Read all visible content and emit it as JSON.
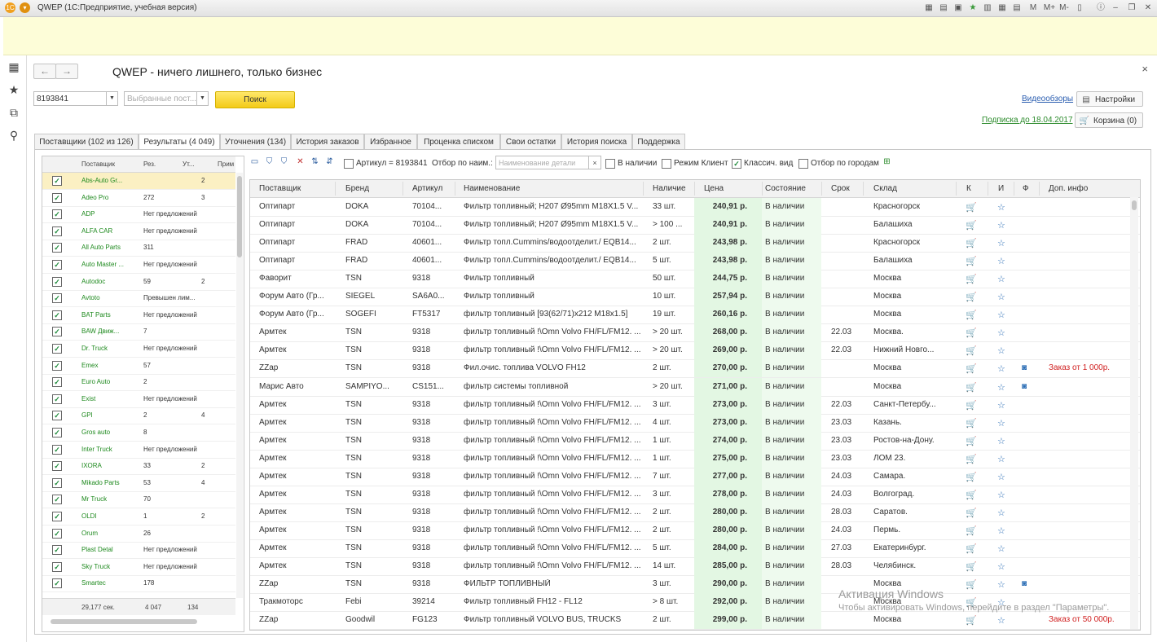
{
  "titlebar": {
    "title": "QWEP  (1С:Предприятие, учебная версия)",
    "icons": [
      "M",
      "M+",
      "M-"
    ]
  },
  "header": {
    "app_title": "QWEP - ничего лишнего, только бизнес"
  },
  "search": {
    "article_value": "8193841",
    "suppliers_placeholder": "Выбранные пост...",
    "search_label": "Поиск"
  },
  "right_links": {
    "video_label": "Видеообзоры",
    "settings_label": "Настройки",
    "subscription_label": "Подписка до 18.04.2017",
    "cart_label": "Корзина (0)"
  },
  "tabs": [
    {
      "label": "Поставщики (102 из 126)",
      "active": false
    },
    {
      "label": "Результаты (4 049)",
      "active": true
    },
    {
      "label": "Уточнения (134)",
      "active": false
    },
    {
      "label": "История заказов",
      "active": false
    },
    {
      "label": "Избранное",
      "active": false
    },
    {
      "label": "Проценка  списком",
      "active": false
    },
    {
      "label": "Свои остатки",
      "active": false
    },
    {
      "label": "История поиска",
      "active": false
    },
    {
      "label": "Поддержка",
      "active": false
    }
  ],
  "left_list": {
    "columns": [
      "Поставщик",
      "Рез.",
      "Ут...",
      "Прим"
    ],
    "rows": [
      {
        "name": "Abs-Auto Gr...",
        "res": "",
        "ut": "2",
        "selected": true
      },
      {
        "name": "Adeo Pro",
        "res": "272",
        "ut": "3"
      },
      {
        "name": "ADP",
        "res": "Нет предложений",
        "ut": ""
      },
      {
        "name": "ALFA CAR",
        "res": "Нет предложений",
        "ut": ""
      },
      {
        "name": "All Auto Parts",
        "res": "311",
        "ut": ""
      },
      {
        "name": "Auto Master ...",
        "res": "Нет предложений",
        "ut": ""
      },
      {
        "name": "Autodoc",
        "res": "59",
        "ut": "2"
      },
      {
        "name": "Avtoto",
        "res": "Превышен лим...",
        "ut": ""
      },
      {
        "name": "BAT Parts",
        "res": "Нет предложений",
        "ut": ""
      },
      {
        "name": "BAW Движ...",
        "res": "7",
        "ut": ""
      },
      {
        "name": "Dr. Truck",
        "res": "Нет предложений",
        "ut": ""
      },
      {
        "name": "Emex",
        "res": "57",
        "ut": ""
      },
      {
        "name": "Euro Auto",
        "res": "2",
        "ut": ""
      },
      {
        "name": "Exist",
        "res": "Нет предложений",
        "ut": ""
      },
      {
        "name": "GPI",
        "res": "2",
        "ut": "4"
      },
      {
        "name": "Gros auto",
        "res": "8",
        "ut": ""
      },
      {
        "name": "Inter Truck",
        "res": "Нет предложений",
        "ut": ""
      },
      {
        "name": "IXORA",
        "res": "33",
        "ut": "2"
      },
      {
        "name": "Mikado Parts",
        "res": "53",
        "ut": "4"
      },
      {
        "name": "Mr Truck",
        "res": "70",
        "ut": ""
      },
      {
        "name": "OLDI",
        "res": "1",
        "ut": "2"
      },
      {
        "name": "Orum",
        "res": "26",
        "ut": ""
      },
      {
        "name": "Plast Detal",
        "res": "Нет предложений",
        "ut": ""
      },
      {
        "name": "Sky Truck",
        "res": "Нет предложений",
        "ut": ""
      },
      {
        "name": "Smartec",
        "res": "178",
        "ut": ""
      }
    ],
    "footer": {
      "time": "29,177 сек.",
      "res": "4 047",
      "ut": "134"
    }
  },
  "toolbar": {
    "article_filter": "Артикул = 8193841",
    "name_filter_label": "Отбор по наим.:",
    "name_filter_placeholder": "Наименование детали",
    "in_stock": "В наличии",
    "client_mode": "Режим Клиент",
    "classic_view": "Классич. вид",
    "city_filter": "Отбор по городам"
  },
  "grid": {
    "columns": [
      "Поставщик",
      "Бренд",
      "Артикул",
      "Наименование",
      "Наличие",
      "Цена",
      "Состояние",
      "Срок",
      "Склад",
      "К",
      "И",
      "Ф",
      "Доп. инфо"
    ],
    "rows": [
      {
        "supplier": "Оптипарт",
        "brand": "DOKA",
        "article": "70104...",
        "name": "Фильтр топливный; H207 Ø95mm M18X1.5 V...",
        "stock": "33 шт.",
        "price": "240,91 р.",
        "state": "В наличии",
        "term": "",
        "warehouse": "Красногорск",
        "cam": false,
        "info": ""
      },
      {
        "supplier": "Оптипарт",
        "brand": "DOKA",
        "article": "70104...",
        "name": "Фильтр топливный; H207 Ø95mm M18X1.5 V...",
        "stock": "> 100 ...",
        "price": "240,91 р.",
        "state": "В наличии",
        "term": "",
        "warehouse": "Балашиха",
        "cam": false,
        "info": ""
      },
      {
        "supplier": "Оптипарт",
        "brand": "FRAD",
        "article": "40601...",
        "name": "Фильтр топл.Cummins/водоотделит./ EQB14...",
        "stock": "2 шт.",
        "price": "243,98 р.",
        "state": "В наличии",
        "term": "",
        "warehouse": "Красногорск",
        "cam": false,
        "info": ""
      },
      {
        "supplier": "Оптипарт",
        "brand": "FRAD",
        "article": "40601...",
        "name": "Фильтр топл.Cummins/водоотделит./ EQB14...",
        "stock": "5 шт.",
        "price": "243,98 р.",
        "state": "В наличии",
        "term": "",
        "warehouse": "Балашиха",
        "cam": false,
        "info": ""
      },
      {
        "supplier": "Фаворит",
        "brand": "TSN",
        "article": "9318",
        "name": "Фильтр топливный",
        "stock": "50 шт.",
        "price": "244,75 р.",
        "state": "В наличии",
        "term": "",
        "warehouse": "Москва",
        "cam": false,
        "info": ""
      },
      {
        "supplier": "Форум Авто (Гр...",
        "brand": "SIEGEL",
        "article": "SA6A0...",
        "name": "Фильтр топливный",
        "stock": "10 шт.",
        "price": "257,94 р.",
        "state": "В наличии",
        "term": "",
        "warehouse": "Москва",
        "cam": false,
        "info": ""
      },
      {
        "supplier": "Форум Авто (Гр...",
        "brand": "SOGEFI",
        "article": "FT5317",
        "name": "фильтр топливный [93(62/71)x212 M18x1.5]",
        "stock": "19 шт.",
        "price": "260,16 р.",
        "state": "В наличии",
        "term": "",
        "warehouse": "Москва",
        "cam": false,
        "info": ""
      },
      {
        "supplier": "Армтек",
        "brand": "TSN",
        "article": "9318",
        "name": "фильтр топливный !\\Omn Volvo FH/FL/FM12. ...",
        "stock": "> 20 шт.",
        "price": "268,00 р.",
        "state": "В наличии",
        "term": "22.03",
        "warehouse": "Москва.",
        "cam": false,
        "info": ""
      },
      {
        "supplier": "Армтек",
        "brand": "TSN",
        "article": "9318",
        "name": "фильтр топливный !\\Omn Volvo FH/FL/FM12. ...",
        "stock": "> 20 шт.",
        "price": "269,00 р.",
        "state": "В наличии",
        "term": "22.03",
        "warehouse": "Нижний Новго...",
        "cam": false,
        "info": ""
      },
      {
        "supplier": "ZZap",
        "brand": "TSN",
        "article": "9318",
        "name": "Фил.очис. топлива VOLVO FH12",
        "stock": "2 шт.",
        "price": "270,00 р.",
        "state": "В наличии",
        "term": "",
        "warehouse": "Москва",
        "cam": true,
        "info": "Заказ от 1 000р."
      },
      {
        "supplier": "Марис Авто",
        "brand": "SAMPIYO...",
        "article": "CS151...",
        "name": "фильтр системы топливной",
        "stock": "> 20 шт.",
        "price": "271,00 р.",
        "state": "В наличии",
        "term": "",
        "warehouse": "Москва",
        "cam": true,
        "info": ""
      },
      {
        "supplier": "Армтек",
        "brand": "TSN",
        "article": "9318",
        "name": "фильтр топливный !\\Omn Volvo FH/FL/FM12. ...",
        "stock": "3 шт.",
        "price": "273,00 р.",
        "state": "В наличии",
        "term": "22.03",
        "warehouse": "Санкт-Петербу...",
        "cam": false,
        "info": ""
      },
      {
        "supplier": "Армтек",
        "brand": "TSN",
        "article": "9318",
        "name": "фильтр топливный !\\Omn Volvo FH/FL/FM12. ...",
        "stock": "4 шт.",
        "price": "273,00 р.",
        "state": "В наличии",
        "term": "23.03",
        "warehouse": "Казань.",
        "cam": false,
        "info": ""
      },
      {
        "supplier": "Армтек",
        "brand": "TSN",
        "article": "9318",
        "name": "фильтр топливный !\\Omn Volvo FH/FL/FM12. ...",
        "stock": "1 шт.",
        "price": "274,00 р.",
        "state": "В наличии",
        "term": "23.03",
        "warehouse": "Ростов-на-Дону.",
        "cam": false,
        "info": ""
      },
      {
        "supplier": "Армтек",
        "brand": "TSN",
        "article": "9318",
        "name": "фильтр топливный !\\Omn Volvo FH/FL/FM12. ...",
        "stock": "1 шт.",
        "price": "275,00 р.",
        "state": "В наличии",
        "term": "23.03",
        "warehouse": "ЛОМ 23.",
        "cam": false,
        "info": ""
      },
      {
        "supplier": "Армтек",
        "brand": "TSN",
        "article": "9318",
        "name": "фильтр топливный !\\Omn Volvo FH/FL/FM12. ...",
        "stock": "7 шт.",
        "price": "277,00 р.",
        "state": "В наличии",
        "term": "24.03",
        "warehouse": "Самара.",
        "cam": false,
        "info": ""
      },
      {
        "supplier": "Армтек",
        "brand": "TSN",
        "article": "9318",
        "name": "фильтр топливный !\\Omn Volvo FH/FL/FM12. ...",
        "stock": "3 шт.",
        "price": "278,00 р.",
        "state": "В наличии",
        "term": "24.03",
        "warehouse": "Волгоград.",
        "cam": false,
        "info": ""
      },
      {
        "supplier": "Армтек",
        "brand": "TSN",
        "article": "9318",
        "name": "фильтр топливный !\\Omn Volvo FH/FL/FM12. ...",
        "stock": "2 шт.",
        "price": "280,00 р.",
        "state": "В наличии",
        "term": "28.03",
        "warehouse": "Саратов.",
        "cam": false,
        "info": ""
      },
      {
        "supplier": "Армтек",
        "brand": "TSN",
        "article": "9318",
        "name": "фильтр топливный !\\Omn Volvo FH/FL/FM12. ...",
        "stock": "2 шт.",
        "price": "280,00 р.",
        "state": "В наличии",
        "term": "24.03",
        "warehouse": "Пермь.",
        "cam": false,
        "info": ""
      },
      {
        "supplier": "Армтек",
        "brand": "TSN",
        "article": "9318",
        "name": "фильтр топливный !\\Omn Volvo FH/FL/FM12. ...",
        "stock": "5 шт.",
        "price": "284,00 р.",
        "state": "В наличии",
        "term": "27.03",
        "warehouse": "Екатеринбург.",
        "cam": false,
        "info": ""
      },
      {
        "supplier": "Армтек",
        "brand": "TSN",
        "article": "9318",
        "name": "фильтр топливный !\\Omn Volvo FH/FL/FM12. ...",
        "stock": "14 шт.",
        "price": "285,00 р.",
        "state": "В наличии",
        "term": "28.03",
        "warehouse": "Челябинск.",
        "cam": false,
        "info": ""
      },
      {
        "supplier": "ZZap",
        "brand": "TSN",
        "article": "9318",
        "name": "ФИЛЬТР ТОПЛИВНЫЙ",
        "stock": "3 шт.",
        "price": "290,00 р.",
        "state": "В наличии",
        "term": "",
        "warehouse": "Москва",
        "cam": true,
        "info": ""
      },
      {
        "supplier": "Тракмоторс",
        "brand": "Febi",
        "article": "39214",
        "name": "Фильтр топливный FH12 - FL12",
        "stock": "> 8 шт.",
        "price": "292,00 р.",
        "state": "В наличии",
        "term": "",
        "warehouse": "Москва",
        "cam": false,
        "info": ""
      },
      {
        "supplier": "ZZap",
        "brand": "Goodwil",
        "article": "FG123",
        "name": "Фильтр топливный VOLVO BUS, TRUCKS",
        "stock": "2 шт.",
        "price": "299,00 р.",
        "state": "В наличии",
        "term": "",
        "warehouse": "Москва",
        "cam": false,
        "info": "Заказ от 50 000р."
      }
    ]
  },
  "watermark": {
    "line1": "Активация Windows",
    "line2": "Чтобы активировать Windows, перейдите в раздел \"Параметры\"."
  }
}
